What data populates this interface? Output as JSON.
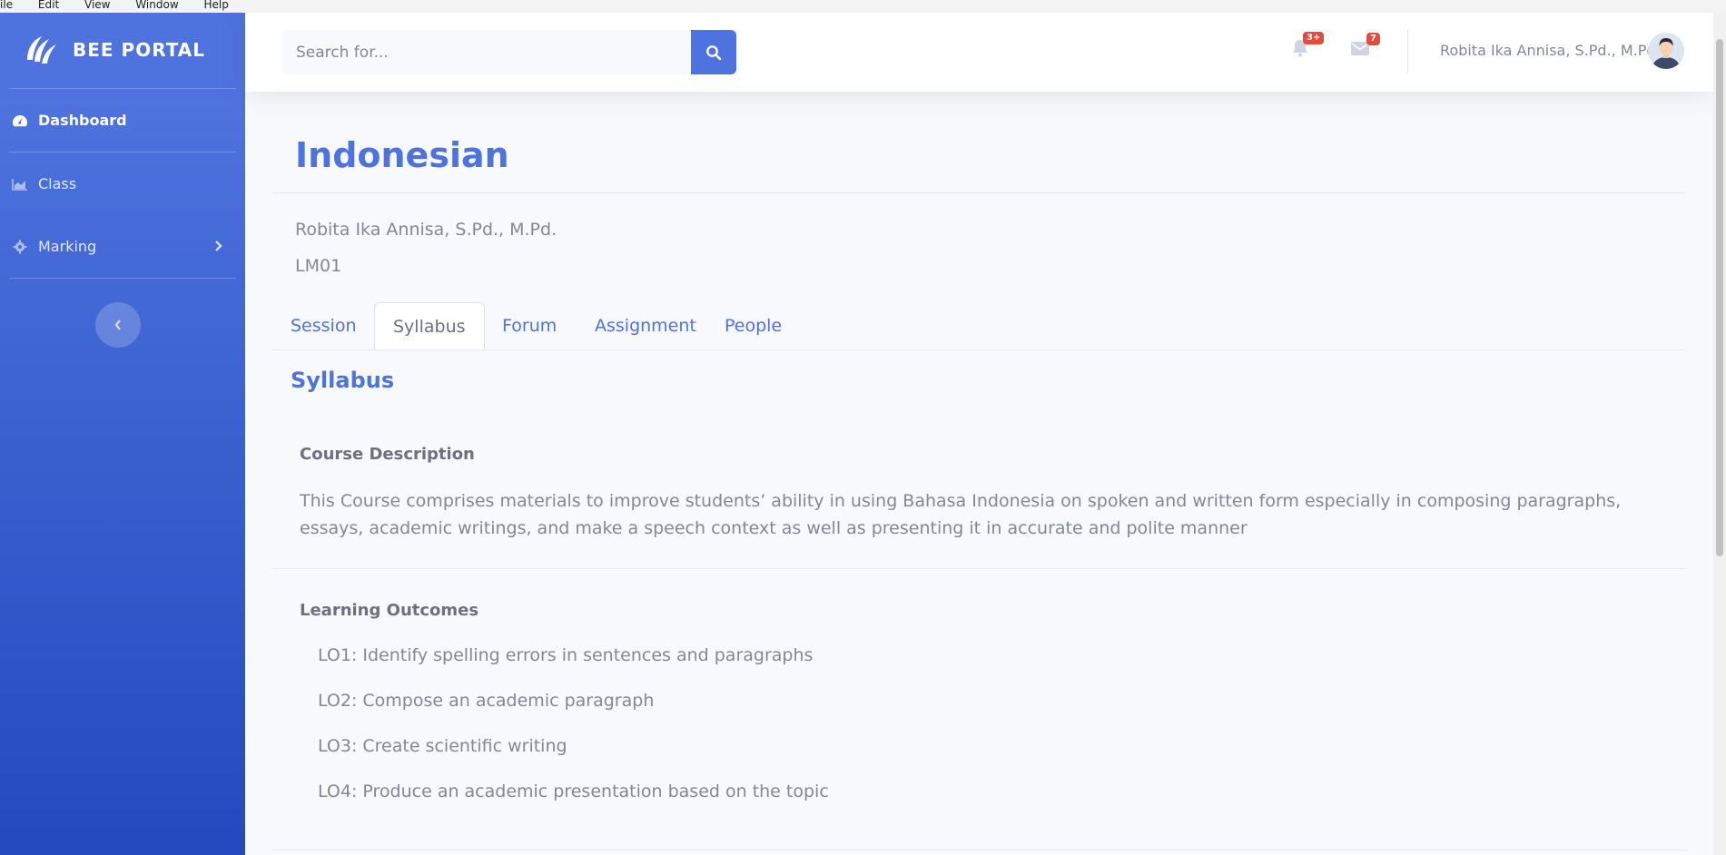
{
  "app_menu": [
    "File",
    "Edit",
    "View",
    "Window",
    "Help"
  ],
  "sidebar": {
    "brand": "BEE PORTAL",
    "items": [
      {
        "label": "Dashboard",
        "icon": "tachometer-icon",
        "active": true
      },
      {
        "label": "Class",
        "icon": "chart-area-icon"
      },
      {
        "label": "Marking",
        "icon": "cog-icon",
        "has_submenu": true
      }
    ]
  },
  "topbar": {
    "search_placeholder": "Search for...",
    "alerts_badge": "3+",
    "messages_badge": "7",
    "user_name": "Robita Ika Annisa, S.Pd., M.Pd."
  },
  "course": {
    "title": "Indonesian",
    "teacher": "Robita Ika Annisa, S.Pd., M.Pd.",
    "code": "LM01"
  },
  "tabs": [
    {
      "label": "Session"
    },
    {
      "label": "Syllabus",
      "active": true
    },
    {
      "label": "Forum"
    },
    {
      "label": "Assignment"
    },
    {
      "label": "People"
    }
  ],
  "syllabus": {
    "heading": "Syllabus",
    "description_heading": "Course Description",
    "description": "This Course comprises materials to improve students’ ability in using Bahasa Indonesia on spoken and written form especially in composing paragraphs, essays, academic writings, and make a speech context as well as presenting it in accurate and polite manner",
    "outcomes_heading": "Learning Outcomes",
    "outcomes": [
      "LO1: Identify spelling errors in sentences and paragraphs",
      "LO2: Compose an academic paragraph",
      "LO3: Create scientific writing",
      "LO4: Produce an academic presentation based on the topic"
    ]
  },
  "colors": {
    "primary": "#4e73df",
    "sidebar_end": "#224abe",
    "badge": "#e74a3b",
    "text_muted": "#858796"
  }
}
